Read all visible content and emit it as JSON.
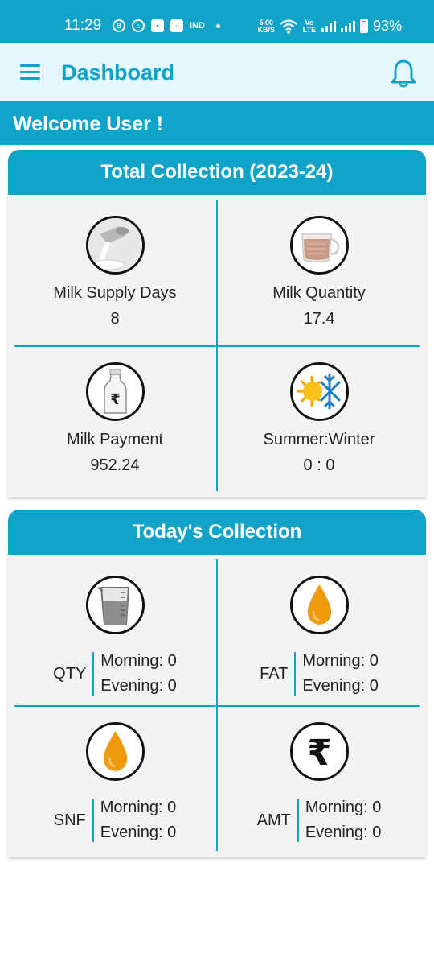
{
  "status_bar": {
    "time": "11:29",
    "icons": [
      "b-circle-icon",
      "home-icon",
      "message-icon",
      "shield-icon",
      "ind-icon"
    ],
    "ind_text": "IND",
    "net_speed_value": "5.00",
    "net_speed_unit": "KB/S",
    "network_label": "Vo LTE",
    "battery": "93%"
  },
  "app_bar": {
    "title": "Dashboard",
    "menu_icon": "hamburger-menu-icon",
    "notification_icon": "bell-icon"
  },
  "welcome": "Welcome User !",
  "total_collection": {
    "title": "Total Collection (2023-24)",
    "items": [
      {
        "label": "Milk Supply Days",
        "value": "8",
        "icon": "milk-pour-icon"
      },
      {
        "label": "Milk Quantity",
        "value": "17.4",
        "icon": "milk-glass-icon"
      },
      {
        "label": "Milk Payment",
        "value": "952.24",
        "icon": "milk-bottle-rupee-icon"
      },
      {
        "label": "Summer:Winter",
        "value": "0 : 0",
        "icon": "sun-snowflake-icon"
      }
    ]
  },
  "todays_collection": {
    "title": "Today's Collection",
    "items": [
      {
        "label": "QTY",
        "morning": "Morning: 0",
        "evening": "Evening: 0",
        "icon": "measuring-beaker-icon"
      },
      {
        "label": "FAT",
        "morning": "Morning: 0",
        "evening": "Evening: 0",
        "icon": "fat-drop-icon"
      },
      {
        "label": "SNF",
        "morning": "Morning: 0",
        "evening": "Evening: 0",
        "icon": "snf-drop-icon"
      },
      {
        "label": "AMT",
        "morning": "Morning: 0",
        "evening": "Evening: 0",
        "icon": "rupee-icon"
      }
    ]
  },
  "colors": {
    "primary": "#12a3c8",
    "app_bar_bg": "#e6f7fc",
    "card_bg": "#f3f3f3",
    "drop_orange": "#ef9a0c"
  }
}
